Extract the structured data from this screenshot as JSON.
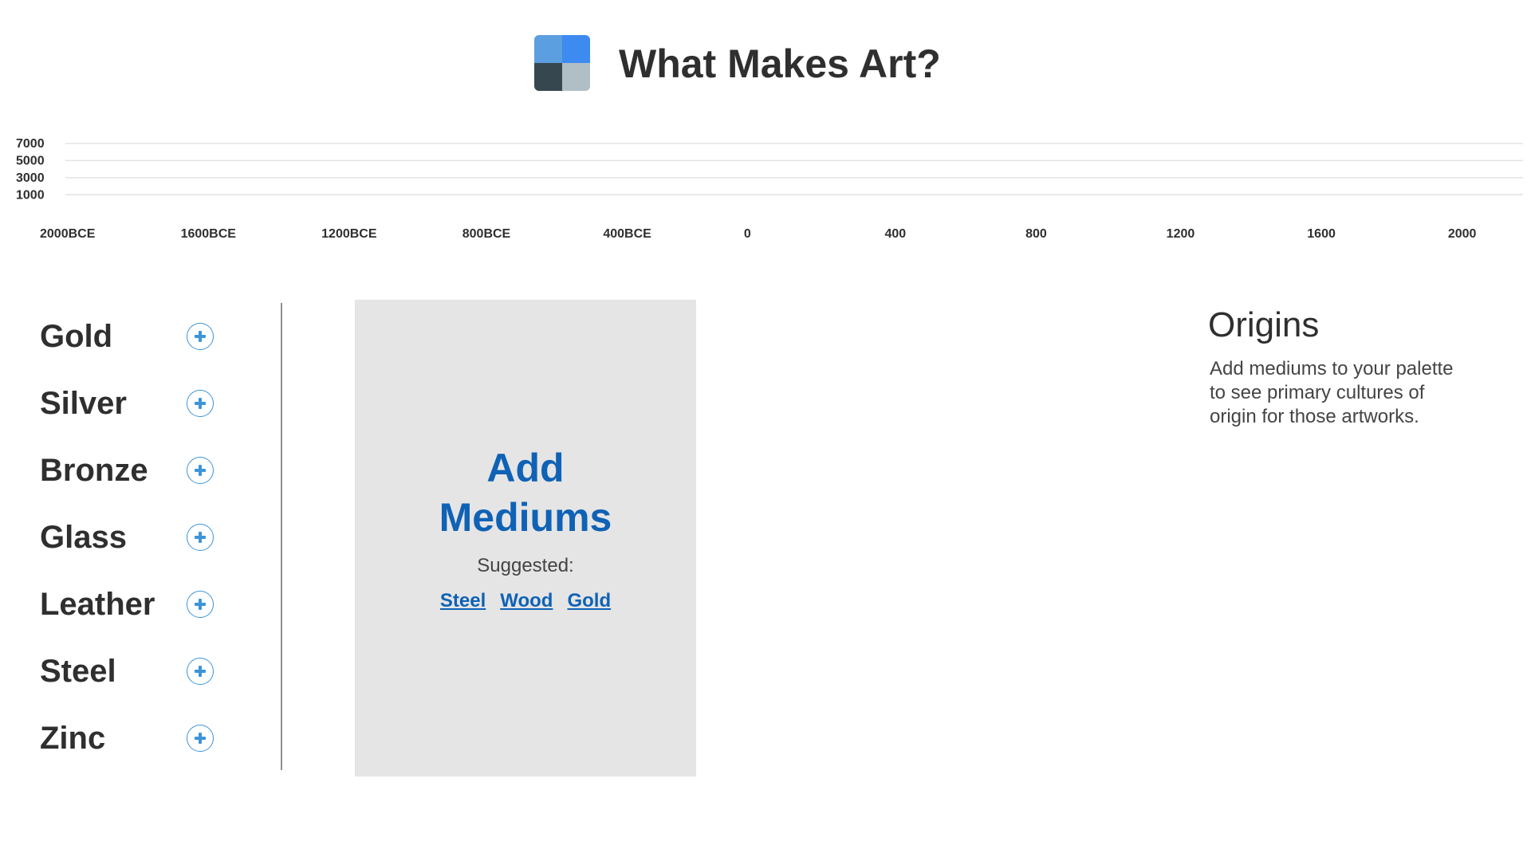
{
  "header": {
    "title": "What Makes Art?",
    "logo_icon": "grid-logo-icon",
    "logo_colors": [
      "#5c9fe0",
      "#3d8bf0",
      "#37474f",
      "#b0bec5"
    ]
  },
  "chart_data": {
    "type": "area",
    "title": "",
    "xlabel": "",
    "ylabel": "",
    "y_ticks": [
      "7000",
      "5000",
      "3000",
      "1000"
    ],
    "x_ticks": [
      "2000BCE",
      "1600BCE",
      "1200BCE",
      "800BCE",
      "400BCE",
      "0",
      "400",
      "800",
      "1200",
      "1600",
      "2000"
    ],
    "x": [
      -2000,
      -1600,
      -1200,
      -800,
      -400,
      0,
      400,
      800,
      1200,
      1600,
      2000
    ],
    "xlim": [
      -2000,
      2100
    ],
    "ylim": [
      0,
      7000
    ],
    "series": [],
    "grid": true
  },
  "mediums": [
    {
      "label": "Gold",
      "icon": "plus-circle-icon"
    },
    {
      "label": "Silver",
      "icon": "plus-circle-icon"
    },
    {
      "label": "Bronze",
      "icon": "plus-circle-icon"
    },
    {
      "label": "Glass",
      "icon": "plus-circle-icon"
    },
    {
      "label": "Leather",
      "icon": "plus-circle-icon"
    },
    {
      "label": "Steel",
      "icon": "plus-circle-icon"
    },
    {
      "label": "Zinc",
      "icon": "plus-circle-icon"
    }
  ],
  "palette": {
    "title_line1": "Add",
    "title_line2": "Mediums",
    "suggested_label": "Suggested:",
    "suggestions": [
      "Steel",
      "Wood",
      "Gold"
    ]
  },
  "origins": {
    "title": "Origins",
    "body": "Add mediums to your palette to see primary cultures of origin for those artworks."
  },
  "colors": {
    "accent": "#0f62b5",
    "icon_blue": "#3d94d8",
    "text": "#2f2f2f",
    "panel_bg": "#e5e5e5"
  }
}
